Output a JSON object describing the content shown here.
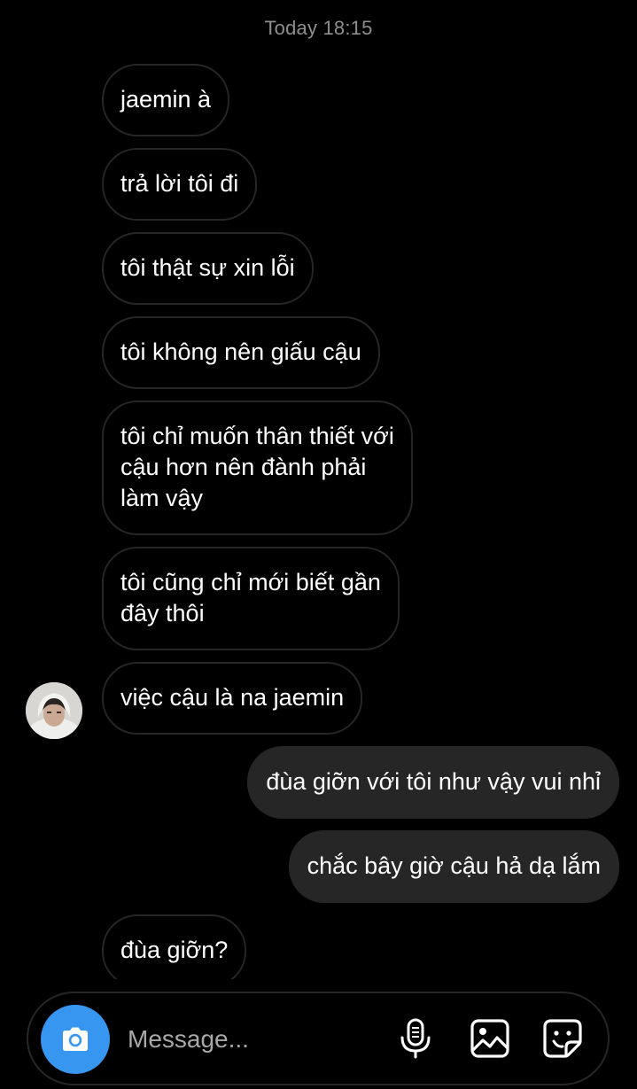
{
  "thread": {
    "timestamp": "Today 18:15",
    "messages": [
      {
        "sender": "them",
        "text": "jaemin à"
      },
      {
        "sender": "them",
        "text": "trả lời tôi đi"
      },
      {
        "sender": "them",
        "text": "tôi thật sự xin lỗi"
      },
      {
        "sender": "them",
        "text": "tôi không nên giấu cậu"
      },
      {
        "sender": "them",
        "text": "tôi chỉ muốn thân thiết với\ncậu hơn nên đành phải\nlàm vậy"
      },
      {
        "sender": "them",
        "text": "tôi cũng chỉ mới biết gần\nđây thôi"
      },
      {
        "sender": "them",
        "text": "việc cậu là na jaemin"
      },
      {
        "sender": "me",
        "text": "đùa giỡn với tôi như vậy vui nhỉ"
      },
      {
        "sender": "me",
        "text": "chắc bây giờ cậu hả dạ lắm"
      },
      {
        "sender": "them",
        "text": "đùa giỡn?"
      }
    ]
  },
  "composer": {
    "placeholder": "Message...",
    "camera_icon": "camera-icon",
    "mic_icon": "microphone-icon",
    "gallery_icon": "image-icon",
    "sticker_icon": "sticker-icon"
  },
  "colors": {
    "background": "#000000",
    "incoming_border": "#262626",
    "outgoing_bubble": "#262626",
    "accent": "#3797f0",
    "timestamp": "#8e8e8e",
    "placeholder": "#a8a8a8"
  }
}
